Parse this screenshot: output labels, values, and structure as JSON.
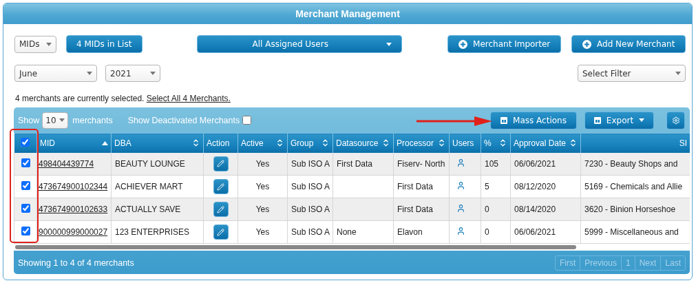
{
  "title": "Merchant Management",
  "toolbar": {
    "list_type": {
      "value": "MIDs"
    },
    "list_count_button": "4 MIDs in List",
    "users_dropdown": "All Assigned Users",
    "buttons": [
      {
        "label": "Merchant Importer"
      },
      {
        "label": "Add New Merchant"
      }
    ]
  },
  "filters": {
    "month": {
      "value": "June"
    },
    "year": {
      "value": "2021"
    },
    "filter": {
      "placeholder": "Select Filter"
    }
  },
  "selection_notice": {
    "text": "4 merchants are currently selected.",
    "link": "Select All 4 Merchants."
  },
  "table_panel": {
    "show_label": "Show",
    "page_size": {
      "value": "10"
    },
    "page_size_suffix": "merchants",
    "deactivated": {
      "label": "Show Deactivated Merchants",
      "checked": false
    },
    "actions": [
      {
        "kind": "mass",
        "label": "Mass Actions"
      },
      {
        "kind": "export",
        "label": "Export"
      },
      {
        "kind": "settings"
      }
    ]
  },
  "table": {
    "select_all": {
      "checked": true
    },
    "columns": [
      {
        "label": "MID",
        "sortable": true,
        "selected": true
      },
      {
        "label": "DBA",
        "sortable": true,
        "selected": false
      },
      {
        "label": "Action",
        "sortable": false,
        "selected": false
      },
      {
        "label": "Active",
        "sortable": true,
        "selected": false
      },
      {
        "label": "Group",
        "sortable": true,
        "selected": false
      },
      {
        "label": "Datasource",
        "sortable": true,
        "selected": false
      },
      {
        "label": "Processor",
        "sortable": true,
        "selected": false
      },
      {
        "label": "Users",
        "sortable": false,
        "selected": false
      },
      {
        "label": "%",
        "sortable": true,
        "selected": false
      },
      {
        "label": "Approval Date",
        "sortable": true,
        "selected": false
      },
      {
        "label": "SI",
        "sortable": false,
        "selected": false
      }
    ],
    "rows": [
      {
        "checked": true,
        "mid": "498404439774",
        "dba": "BEAUTY LOUNGE",
        "active": "Yes",
        "group": "Sub ISO A",
        "datasource": "First Data",
        "processor": "Fiserv- North",
        "percent": "105",
        "approval_date": "06/06/2021",
        "sic": "7230 - Beauty Shops and"
      },
      {
        "checked": true,
        "mid": "473674900102344",
        "dba": "ACHIEVER MART",
        "active": "Yes",
        "group": "Sub ISO A",
        "processor": "First Data",
        "percent": "5",
        "approval_date": "08/12/2020",
        "sic": "5169 - Chemicals and Allie"
      },
      {
        "checked": true,
        "mid": "473674900102633",
        "dba": "ACTUALLY SAVE",
        "active": "Yes",
        "group": "Sub ISO A",
        "processor": "First Data",
        "percent": "0",
        "approval_date": "08/14/2020",
        "sic": "3620 - Binion Horseshoe"
      },
      {
        "checked": true,
        "mid": "900000999000027",
        "dba": "123 ENTERPRISES",
        "active": "Yes",
        "group": "Sub ISO A",
        "datasource": "None",
        "processor": "Elavon",
        "percent": "0",
        "approval_date": "06/06/2021",
        "sic": "5999 - Miscellaneous and"
      }
    ],
    "summary": "Showing 1 to 4 of 4 merchants",
    "pagination": [
      {
        "label": "First",
        "disabled": true
      },
      {
        "label": "Previous",
        "disabled": true
      },
      {
        "label": "1",
        "disabled": true
      },
      {
        "label": "Next",
        "disabled": true
      },
      {
        "label": "Last",
        "disabled": true
      }
    ]
  },
  "annotations": {
    "highlight_box": true,
    "arrow": true
  }
}
